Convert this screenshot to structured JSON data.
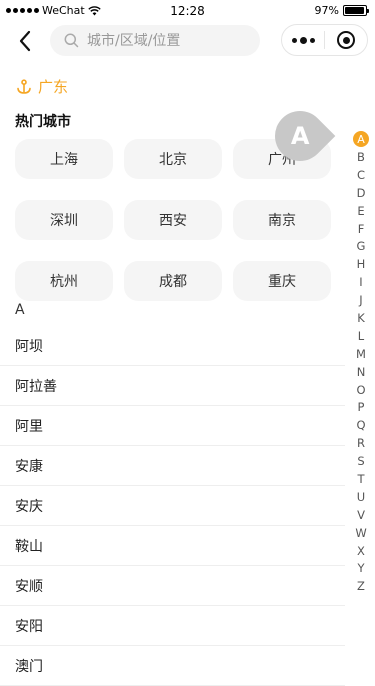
{
  "status_bar": {
    "carrier": "WeChat",
    "time": "12:28",
    "battery": "97%",
    "battery_level": 0.97
  },
  "nav": {
    "search_placeholder": "城市/区域/位置"
  },
  "location": {
    "current": "广东",
    "accent_color": "#f5a623"
  },
  "hot_cities": {
    "title": "热门城市",
    "items": [
      "上海",
      "北京",
      "广州",
      "深圳",
      "西安",
      "南京",
      "杭州",
      "成都",
      "重庆"
    ]
  },
  "current_section": {
    "letter": "A",
    "cities": [
      "阿坝",
      "阿拉善",
      "阿里",
      "安康",
      "安庆",
      "鞍山",
      "安顺",
      "安阳",
      "澳门"
    ]
  },
  "index_bar": {
    "letters": [
      "A",
      "B",
      "C",
      "D",
      "E",
      "F",
      "G",
      "H",
      "I",
      "J",
      "K",
      "L",
      "M",
      "N",
      "O",
      "P",
      "Q",
      "R",
      "S",
      "T",
      "U",
      "V",
      "W",
      "X",
      "Y",
      "Z"
    ],
    "active": "A"
  },
  "index_bubble": {
    "letter": "A"
  }
}
